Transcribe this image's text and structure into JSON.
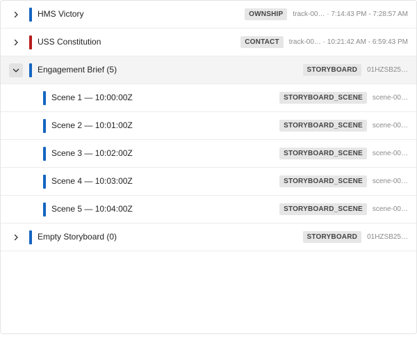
{
  "colors": {
    "ownship_bar": "#1565c0",
    "contact_bar": "#b71c1c",
    "storyboard_bar": "#1565c0"
  },
  "rows": [
    {
      "label": "HMS Victory",
      "badge": "OWNSHIP",
      "meta": "track-00… · 7:14:43 PM - 7:28:57 AM",
      "expander": "chevron-right-icon",
      "bar_color": "#1565c0"
    },
    {
      "label": "USS Constitution",
      "badge": "CONTACT",
      "meta": "track-00… · 10:21:42 AM - 6:59:43 PM",
      "expander": "chevron-right-icon",
      "bar_color": "#b71c1c"
    },
    {
      "label": "Engagement Brief (5)",
      "badge": "STORYBOARD",
      "meta": "01HZSB25…",
      "expander": "chevron-down-icon",
      "bar_color": "#1565c0",
      "selected": true
    },
    {
      "label": "Scene 1 — 10:00:00Z",
      "badge": "STORYBOARD_SCENE",
      "meta": "scene-00…",
      "bar_color": "#1565c0"
    },
    {
      "label": "Scene 2 — 10:01:00Z",
      "badge": "STORYBOARD_SCENE",
      "meta": "scene-00…",
      "bar_color": "#1565c0"
    },
    {
      "label": "Scene 3 — 10:02:00Z",
      "badge": "STORYBOARD_SCENE",
      "meta": "scene-00…",
      "bar_color": "#1565c0"
    },
    {
      "label": "Scene 4 — 10:03:00Z",
      "badge": "STORYBOARD_SCENE",
      "meta": "scene-00…",
      "bar_color": "#1565c0"
    },
    {
      "label": "Scene 5 — 10:04:00Z",
      "badge": "STORYBOARD_SCENE",
      "meta": "scene-00…",
      "bar_color": "#1565c0"
    },
    {
      "label": "Empty Storyboard (0)",
      "badge": "STORYBOARD",
      "meta": "01HZSB25…",
      "expander": "chevron-right-icon",
      "bar_color": "#1565c0"
    }
  ]
}
